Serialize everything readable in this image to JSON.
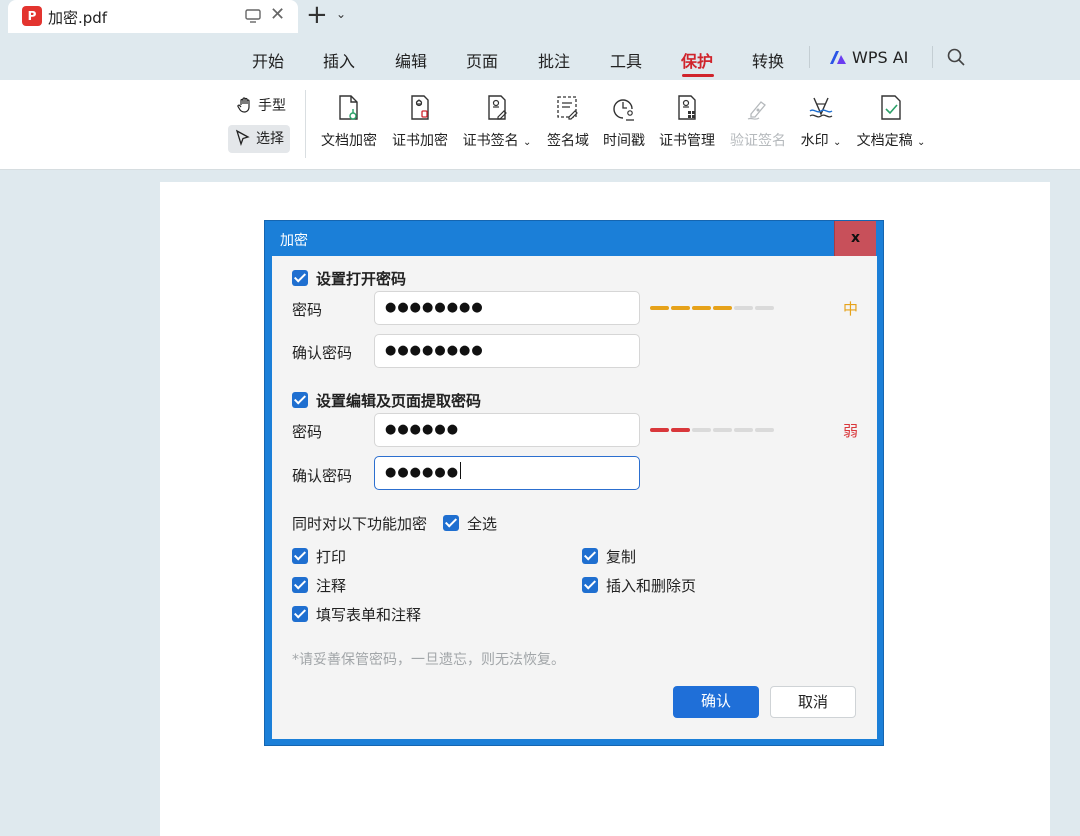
{
  "tab": {
    "badge": "P",
    "title": "加密.pdf",
    "close": "✕",
    "new_tab": "+",
    "new_tab_caret": "⌄"
  },
  "menu": {
    "items": [
      "开始",
      "插入",
      "编辑",
      "页面",
      "批注",
      "工具",
      "保护",
      "转换"
    ],
    "active": "保护",
    "ai_label": "WPS AI"
  },
  "toolbar": {
    "hand": "手型",
    "select": "选择",
    "tools": [
      {
        "label": "文档加密",
        "icon": "doc-lock-icon"
      },
      {
        "label": "证书加密",
        "icon": "cert-lock-icon"
      },
      {
        "label": "证书签名",
        "icon": "cert-sign-icon",
        "caret": "⌄"
      },
      {
        "label": "签名域",
        "icon": "sign-field-icon"
      },
      {
        "label": "时间戳",
        "icon": "timestamp-icon"
      },
      {
        "label": "证书管理",
        "icon": "cert-manage-icon"
      },
      {
        "label": "验证签名",
        "icon": "verify-sign-icon",
        "disabled": true
      },
      {
        "label": "水印",
        "icon": "watermark-icon",
        "caret": "⌄"
      },
      {
        "label": "文档定稿",
        "icon": "finalize-icon",
        "caret": "⌄"
      }
    ]
  },
  "dialog": {
    "title": "加密",
    "close": "x",
    "open_pw": {
      "heading": "设置打开密码",
      "password_label": "密码",
      "password_value": "●●●●●●●●",
      "confirm_label": "确认密码",
      "confirm_value": "●●●●●●●●",
      "strength_label": "中",
      "strength_level": 4,
      "strength_total": 6,
      "strength_color": "#e6a21a"
    },
    "edit_pw": {
      "heading": "设置编辑及页面提取密码",
      "password_label": "密码",
      "password_value": "●●●●●●",
      "confirm_label": "确认密码",
      "confirm_value": "●●●●●●",
      "strength_label": "弱",
      "strength_level": 2,
      "strength_total": 6,
      "strength_color": "#d9373b"
    },
    "functions_label": "同时对以下功能加密",
    "select_all": "全选",
    "options": {
      "print": "打印",
      "copy": "复制",
      "annotate": "注释",
      "insert_delete": "插入和删除页",
      "fill_forms": "填写表单和注释"
    },
    "hint": "*请妥善保管密码，一旦遗忘，则无法恢复。",
    "ok": "确认",
    "cancel": "取消"
  }
}
